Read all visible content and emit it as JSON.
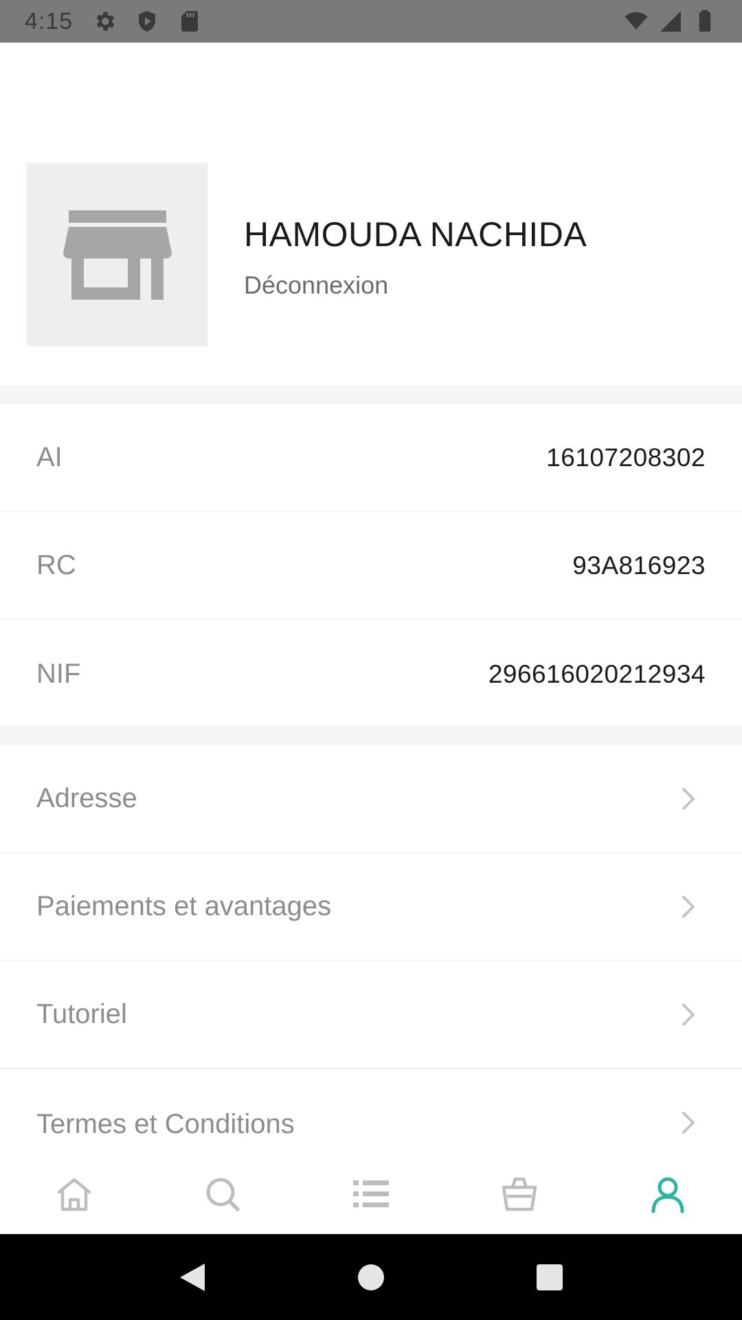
{
  "status_bar": {
    "time": "4:15",
    "icons_left": [
      "gear-icon",
      "shield-icon",
      "sd-card-icon"
    ],
    "icons_right": [
      "wifi-icon",
      "signal-icon",
      "battery-icon"
    ]
  },
  "profile": {
    "avatar_icon": "store-icon",
    "name": "HAMOUDA NACHIDA",
    "logout_label": "Déconnexion"
  },
  "info": [
    {
      "label": "AI",
      "value": "16107208302"
    },
    {
      "label": "RC",
      "value": "93A816923"
    },
    {
      "label": "NIF",
      "value": "296616020212934"
    }
  ],
  "menu": [
    {
      "label": "Adresse"
    },
    {
      "label": "Paiements et avantages"
    },
    {
      "label": "Tutoriel"
    },
    {
      "label": "Termes et Conditions"
    }
  ],
  "bottom_nav": {
    "items": [
      {
        "icon": "home-icon",
        "active": false
      },
      {
        "icon": "search-icon",
        "active": false
      },
      {
        "icon": "list-icon",
        "active": false
      },
      {
        "icon": "basket-icon",
        "active": false
      },
      {
        "icon": "user-icon",
        "active": true
      }
    ],
    "active_color": "#2bb5a0",
    "inactive_color": "#bdbdbd"
  },
  "system_nav": [
    "back-icon",
    "home-circle-icon",
    "recents-icon"
  ]
}
